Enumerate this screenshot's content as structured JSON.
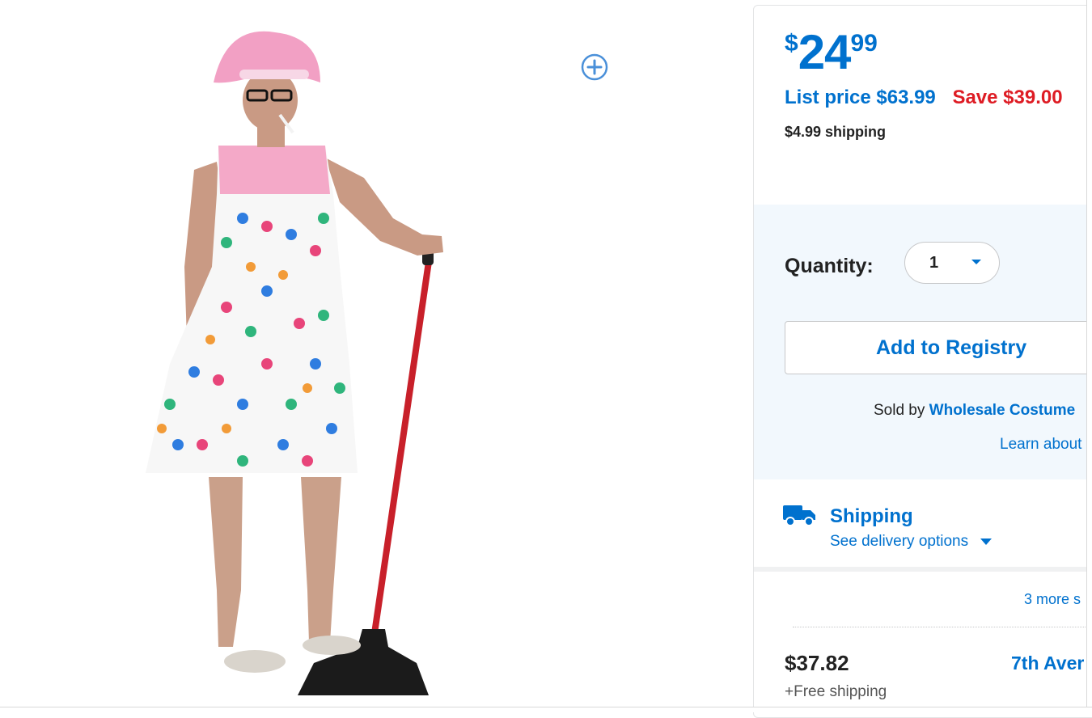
{
  "colors": {
    "brand_blue": "#0071ce",
    "save_red": "#de1c24",
    "qty_section_bg": "#f2f8fd",
    "dress_pink": "#f4a9c8",
    "broom_red": "#c8202a"
  },
  "product_image": {
    "zoom_icon": "zoom-in-plus-icon"
  },
  "price": {
    "currency": "$",
    "dollars": "24",
    "cents": "99",
    "list_price": "List price $63.99",
    "save": "Save $39.00",
    "shipping_fee": "$4.99 shipping"
  },
  "quantity": {
    "label": "Quantity:",
    "value": "1"
  },
  "registry_button": "Add to Registry",
  "sold_by": {
    "prefix": "Sold by ",
    "seller": "Wholesale Costume",
    "learn_link": "Learn about"
  },
  "shipping": {
    "icon": "truck-icon",
    "title": "Shipping",
    "options_link": "See delivery options"
  },
  "more_sellers": "3 more s",
  "offer": {
    "price": "$37.82",
    "seller": "7th Aver",
    "shipping": "+Free shipping"
  }
}
